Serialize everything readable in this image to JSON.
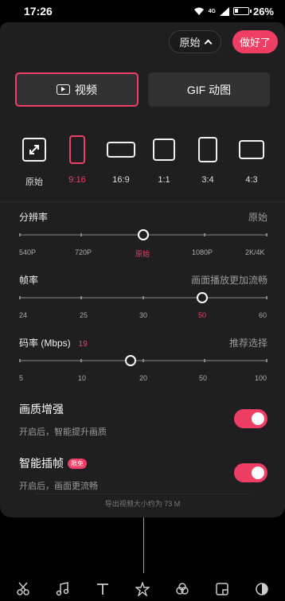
{
  "status": {
    "time": "17:26",
    "battery_pct": "26%",
    "network": "4G"
  },
  "header": {
    "preset_label": "原始",
    "done_label": "做好了"
  },
  "modes": {
    "video_label": "视频",
    "gif_label": "GIF 动图",
    "active": "video"
  },
  "ratios": {
    "items": [
      {
        "label": "原始"
      },
      {
        "label": "9:16"
      },
      {
        "label": "16:9"
      },
      {
        "label": "1:1"
      },
      {
        "label": "3:4"
      },
      {
        "label": "4:3"
      }
    ],
    "selected": "9:16"
  },
  "resolution": {
    "title": "分辨率",
    "value_label": "原始",
    "ticks": [
      "540P",
      "720P",
      "原始",
      "1080P",
      "2K/4K"
    ],
    "selected": "原始"
  },
  "framerate": {
    "title": "帧率",
    "hint": "画面播放更加流畅",
    "ticks": [
      "24",
      "25",
      "30",
      "50",
      "60"
    ],
    "selected": "50"
  },
  "bitrate": {
    "title": "码率 (Mbps)",
    "current": "19",
    "value_label": "推荐选择",
    "ticks": [
      "5",
      "10",
      "20",
      "50",
      "100"
    ],
    "level": 0.45
  },
  "enhance": {
    "title": "画质增强",
    "subtitle": "开启后，智能提升画质",
    "enabled": true
  },
  "interp": {
    "title": "智能插帧",
    "badge": "限免",
    "subtitle": "开启后，画面更流畅",
    "enabled": true
  },
  "export_size": "导出视频大小约为 73 M",
  "toolbar": {
    "icons": [
      "scissors-icon",
      "music-icon",
      "text-icon",
      "effects-icon",
      "filter-icon",
      "sticker-icon",
      "canvas-icon"
    ]
  },
  "colors": {
    "accent": "#ef3e63",
    "panel": "#1f1f21"
  }
}
